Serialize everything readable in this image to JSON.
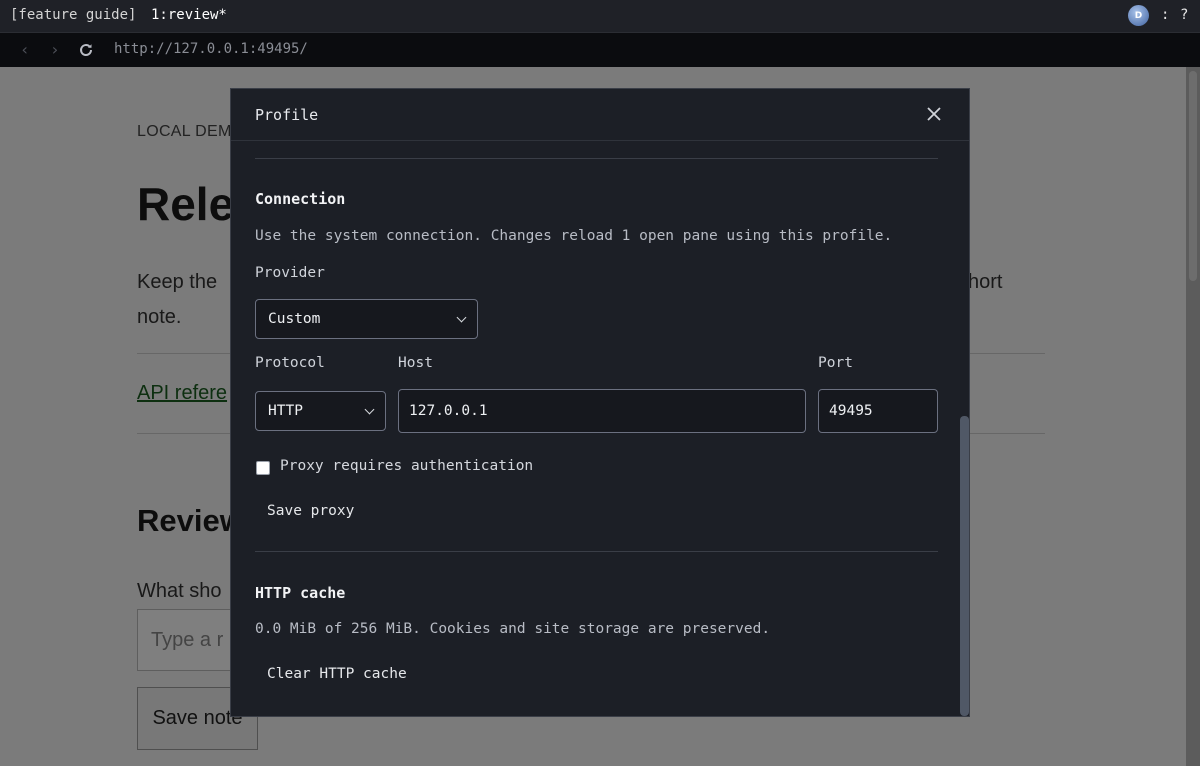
{
  "titlebar": {
    "session": "[feature guide]",
    "tab": "1:review*",
    "avatar_initial": "D",
    "more": ":",
    "help": "?"
  },
  "urlbar": {
    "back_icon": "chevron-left-icon",
    "forward_icon": "chevron-right-icon",
    "reload_icon": "reload-icon",
    "url": "http://127.0.0.1:49495/"
  },
  "page": {
    "eyebrow": "LOCAL DEM",
    "title": "Rele",
    "lead_start": "Keep the",
    "lead_tail": "hort",
    "lead_line2": "note.",
    "link": "API refere",
    "section_heading": "Review",
    "question": "What sho",
    "input_placeholder": "Type a r",
    "save_note": "Save note"
  },
  "modal": {
    "title": "Profile",
    "close_icon": "close-icon",
    "connection": {
      "heading": "Connection",
      "description": "Use the system connection. Changes reload 1 open pane using this profile.",
      "provider_label": "Provider",
      "provider_value": "Custom",
      "protocol_label": "Protocol",
      "protocol_value": "HTTP",
      "host_label": "Host",
      "host_value": "127.0.0.1",
      "port_label": "Port",
      "port_value": "49495",
      "auth_label": "Proxy requires authentication",
      "auth_checked": false,
      "save_proxy": "Save proxy"
    },
    "cache": {
      "heading": "HTTP cache",
      "description": "0.0 MiB of 256 MiB. Cookies and site storage are preserved.",
      "clear_button": "Clear HTTP cache"
    }
  }
}
